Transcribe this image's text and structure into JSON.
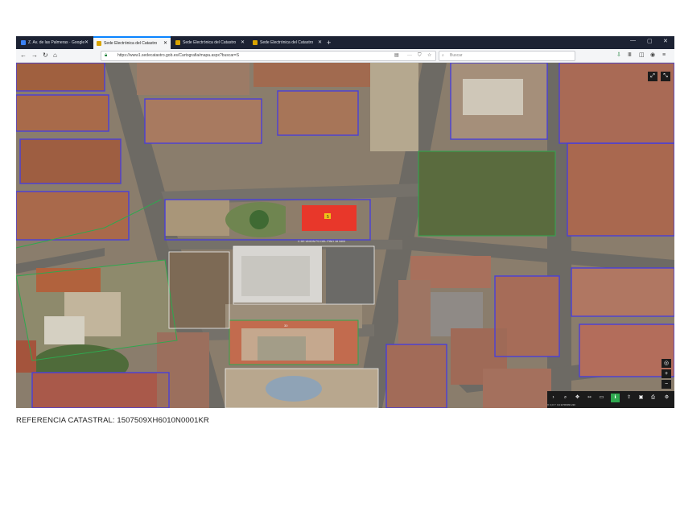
{
  "browser": {
    "tabs": [
      {
        "label": "Z. Av. de las Palmeras · Google",
        "favicon": "map-pin-icon"
      },
      {
        "label": "Sede Electrónica del Catastro",
        "favicon": "catastro-icon"
      },
      {
        "label": "Sede Electrónica del Catastro",
        "favicon": "catastro-icon"
      },
      {
        "label": "Sede Electrónica del Catastro",
        "favicon": "catastro-icon"
      }
    ],
    "active_tab": 1,
    "url": "https://www1.sedecatastro.gob.es/Cartografia/mapa.aspx?buscar=S",
    "search_placeholder": "Buscar",
    "colors": {
      "chrome_dark": "#1c2233",
      "accent": "#0a84ff",
      "toolbar": "#f4f5f7"
    }
  },
  "map": {
    "building_label": "5",
    "street_label": "C DE UNION PG DEL PINO 18 3403",
    "lower_parcel_label": "30",
    "colors": {
      "selected_parcel": "#e8372a",
      "parcel_outline": "#4a3fd8",
      "green_outline": "#2fa84f"
    },
    "controls": {
      "top_right": [
        "fullscreen-icon",
        "expand-icon"
      ],
      "zoom": [
        "locate-icon",
        "+",
        "−",
        "layers-icon"
      ],
      "bottom_toolbar": [
        "arrow-icon",
        "search-icon",
        "pan-icon",
        "measure-icon",
        "ruler-icon",
        "info-icon",
        "share-icon",
        "photo-icon",
        "print-icon",
        "settings-icon"
      ],
      "coord_text": "X: 0,0 Y: 0,0 ETRS89 H30"
    }
  },
  "caption": "REFERENCIA CATASTRAL: 1507509XH6010N0001KR"
}
